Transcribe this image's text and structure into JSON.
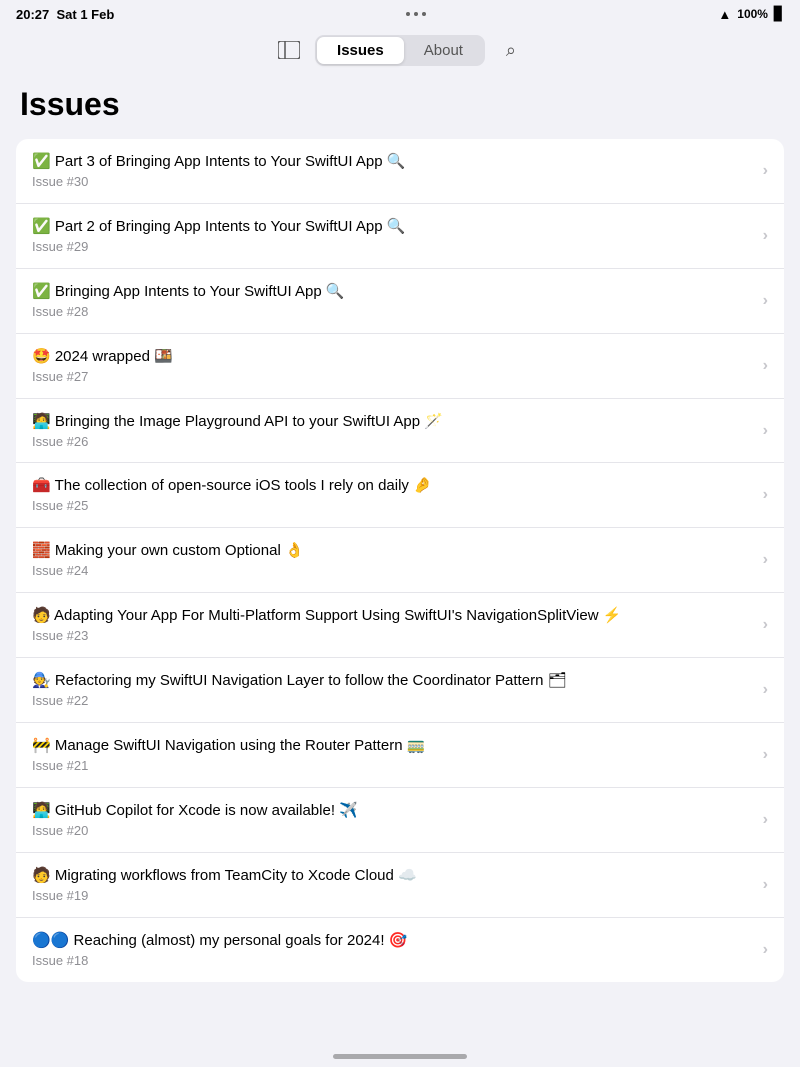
{
  "statusBar": {
    "time": "20:27",
    "date": "Sat 1 Feb",
    "battery": "100%"
  },
  "nav": {
    "tabs": [
      {
        "id": "issues",
        "label": "Issues",
        "active": true
      },
      {
        "id": "about",
        "label": "About",
        "active": false
      }
    ],
    "sidebarIcon": "sidebar-icon",
    "searchIcon": "search-icon"
  },
  "page": {
    "title": "Issues"
  },
  "issues": [
    {
      "title": "✅ Part 3 of Bringing App Intents to Your SwiftUI App 🔍",
      "subtitle": "Issue #30"
    },
    {
      "title": "✅ Part 2 of Bringing App Intents to Your SwiftUI App 🔍",
      "subtitle": "Issue #29"
    },
    {
      "title": "✅ Bringing App Intents to Your SwiftUI App 🔍",
      "subtitle": "Issue #28"
    },
    {
      "title": "🤩 2024 wrapped 🍱",
      "subtitle": "Issue #27"
    },
    {
      "title": "🧑‍💻 Bringing the Image Playground API to your SwiftUI App 🪄",
      "subtitle": "Issue #26"
    },
    {
      "title": "🧰 The collection of open-source iOS tools I rely on daily 🤌",
      "subtitle": "Issue #25"
    },
    {
      "title": "🧱 Making your own custom Optional 👌",
      "subtitle": "Issue #24"
    },
    {
      "title": "🧑 Adapting Your App For Multi-Platform Support Using SwiftUI's NavigationSplitView ⚡",
      "subtitle": "Issue #23"
    },
    {
      "title": "🧑‍🔧 Refactoring my SwiftUI Navigation Layer to follow the Coordinator Pattern 🗂",
      "subtitle": "Issue #22"
    },
    {
      "title": "🚧 Manage SwiftUI Navigation using the Router Pattern 🚃",
      "subtitle": "Issue #21"
    },
    {
      "title": "🧑‍💻 GitHub Copilot for Xcode is now available! ✈️",
      "subtitle": "Issue #20"
    },
    {
      "title": "🧑 Migrating workflows from TeamCity to Xcode Cloud ☁️",
      "subtitle": "Issue #19"
    },
    {
      "title": "🔵🔵 Reaching (almost) my personal goals for 2024! 🎯",
      "subtitle": "Issue #18"
    }
  ]
}
